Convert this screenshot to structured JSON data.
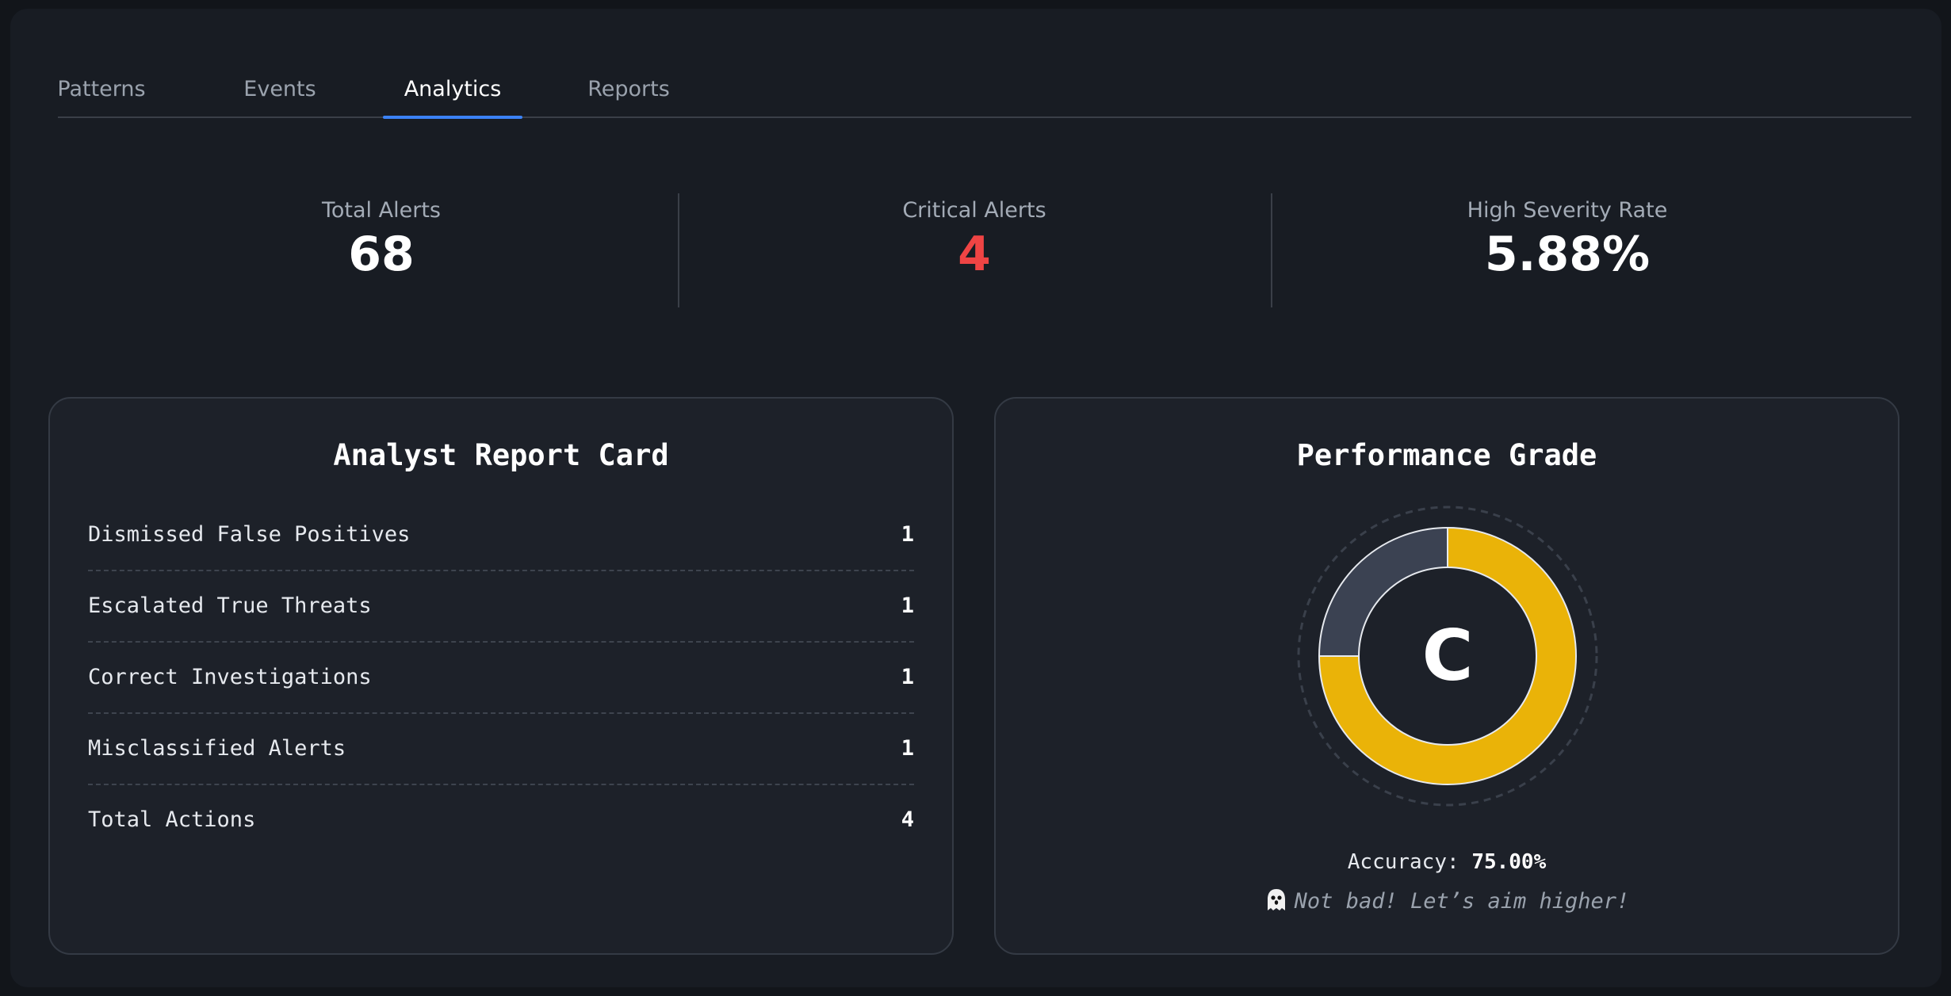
{
  "tabs": [
    {
      "label": "Patterns",
      "active": false
    },
    {
      "label": "Events",
      "active": false
    },
    {
      "label": "Analytics",
      "active": true
    },
    {
      "label": "Reports",
      "active": false
    }
  ],
  "stats": {
    "total_alerts": {
      "label": "Total Alerts",
      "value": "68"
    },
    "critical_alerts": {
      "label": "Critical Alerts",
      "value": "4",
      "color": "#ef4444"
    },
    "high_severity_rate": {
      "label": "High Severity Rate",
      "value": "5.88%"
    }
  },
  "report_card": {
    "title": "Analyst Report Card",
    "rows": [
      {
        "label": "Dismissed False Positives",
        "value": "1"
      },
      {
        "label": "Escalated True Threats",
        "value": "1"
      },
      {
        "label": "Correct Investigations",
        "value": "1"
      },
      {
        "label": "Misclassified Alerts",
        "value": "1"
      },
      {
        "label": "Total Actions",
        "value": "4"
      }
    ]
  },
  "performance": {
    "title": "Performance Grade",
    "grade": "C",
    "accuracy_label": "Accuracy:",
    "accuracy_value": "75.00%",
    "accuracy_fraction": 0.75,
    "message_icon": "ghost-icon",
    "message": "Not bad! Let’s aim higher!",
    "colors": {
      "filled": "#eab308",
      "remaining": "#3b4252",
      "accent": "#3b82f6"
    }
  }
}
